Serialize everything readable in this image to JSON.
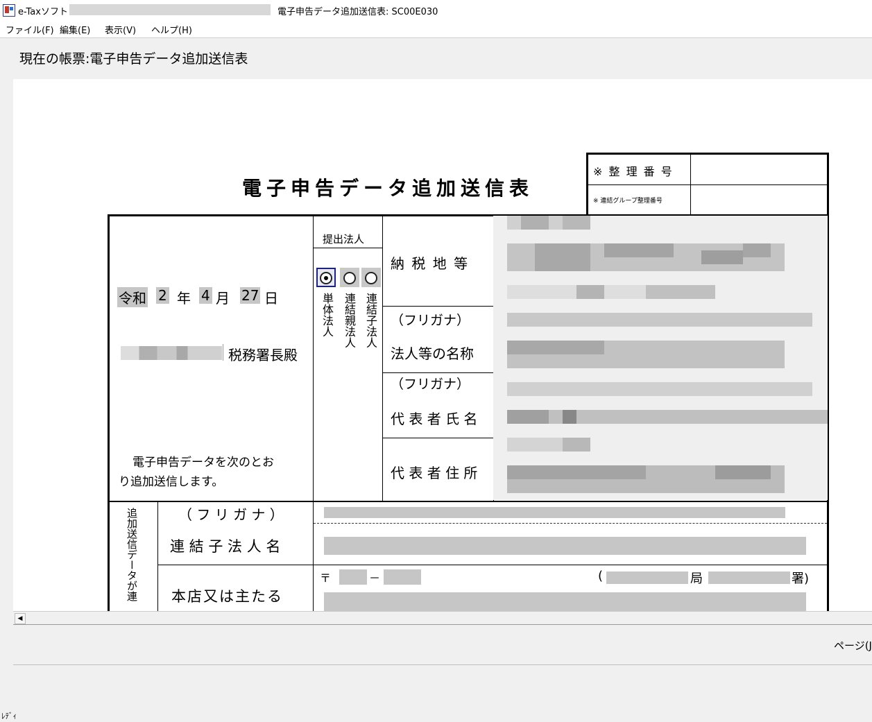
{
  "window": {
    "app_name": "e-Taxソフト",
    "form_title": "電子申告データ追加送信表: SC00E030"
  },
  "menu": [
    "ファイル(F)",
    "編集(E)",
    "表示(V)",
    "ヘルプ(H)"
  ],
  "current_form_label": "現在の帳票:電子申告データ追加送信表",
  "form": {
    "title": "電子申告データ追加送信表",
    "ref_number_label": "※ 整 理 番 号",
    "group_ref_label": "※ 連結グループ整理番号",
    "submitter_label": "提出法人",
    "date": {
      "era": "令和",
      "year": "2",
      "year_unit": "年",
      "month": "4",
      "month_unit": "月",
      "day": "27",
      "day_unit": "日"
    },
    "tax_office_suffix": "税務署長殿",
    "statement": [
      "電子申告データを次のとお",
      "り追加送信します。"
    ],
    "radio_options": [
      {
        "label": "単体法人",
        "selected": true
      },
      {
        "label": "連結親法人",
        "selected": false
      },
      {
        "label": "連結子法人",
        "selected": false
      }
    ],
    "fields": {
      "tax_place": "納 税 地 等",
      "furigana": "（フリガナ）",
      "corp_name": "法人等の名称",
      "rep_name": "代 表 者 氏 名",
      "rep_address": "代 表 者 住 所"
    },
    "side_label": "追加送信データが連",
    "sub_furigana": "（ フ リ ガ ナ ）",
    "sub_corp_name": "連 結 子 法 人 名",
    "head_office": "本店又は主たる",
    "postal_mark": "〒",
    "postal_dash": "－",
    "paren_open": "(",
    "bureau": "局",
    "office": "署)"
  },
  "footer": {
    "page_label": "ページ(J)",
    "status": "ﾚﾃﾞｨ"
  }
}
